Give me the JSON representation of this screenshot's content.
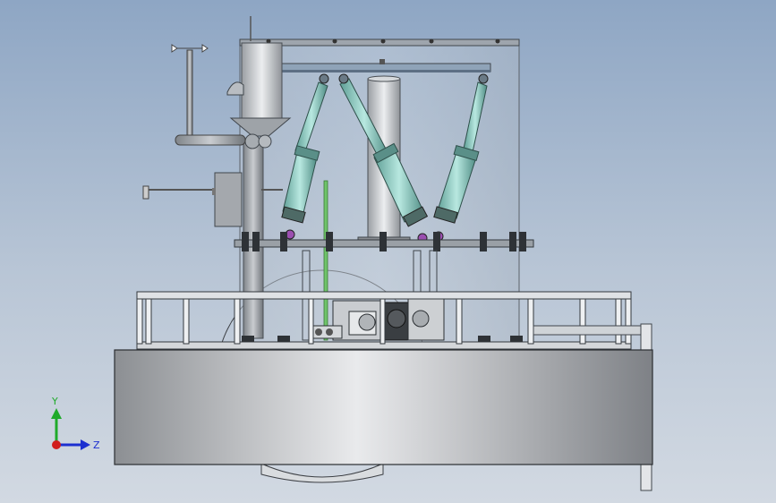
{
  "viewport": {
    "background_top": "#8ea6c4",
    "background_bottom": "#d2d9e2"
  },
  "model": {
    "components": [
      "wind-vane",
      "vent-pipe",
      "hopper-funnel",
      "electrical-box",
      "tank-shell",
      "top-frame-bar",
      "stewart-actuator-left",
      "stewart-actuator-middle",
      "stewart-actuator-right",
      "center-column",
      "mounting-plate",
      "guard-railing",
      "drive-mechanism",
      "base-pontoon",
      "rotor-disc",
      "outrigger-pipe"
    ],
    "actuator_color": "#8fcfc6",
    "steel_color": "#a9adb3"
  },
  "triad": {
    "y_label": "Y",
    "z_label": "Z",
    "y_color": "#1faa2a",
    "z_color": "#1c2fd0",
    "x_color": "#d11d1d"
  }
}
